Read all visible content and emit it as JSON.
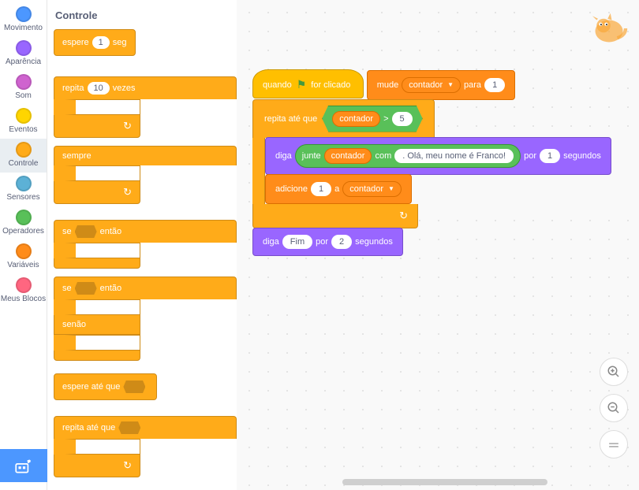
{
  "categories": [
    {
      "id": "movimento",
      "label": "Movimento",
      "color": "#4c97ff"
    },
    {
      "id": "aparencia",
      "label": "Aparência",
      "color": "#9966ff"
    },
    {
      "id": "som",
      "label": "Som",
      "color": "#cf63cf"
    },
    {
      "id": "eventos",
      "label": "Eventos",
      "color": "#ffd500"
    },
    {
      "id": "controle",
      "label": "Controle",
      "color": "#ffab19",
      "active": true
    },
    {
      "id": "sensores",
      "label": "Sensores",
      "color": "#5cb1d6"
    },
    {
      "id": "operadores",
      "label": "Operadores",
      "color": "#59c059"
    },
    {
      "id": "variaveis",
      "label": "Variáveis",
      "color": "#ff8c1a"
    },
    {
      "id": "meusblocos",
      "label": "Meus Blocos",
      "color": "#ff6680"
    }
  ],
  "palette": {
    "title": "Controle",
    "wait": {
      "pre": "espere",
      "val": "1",
      "post": "seg"
    },
    "repeat": {
      "pre": "repita",
      "val": "10",
      "post": "vezes"
    },
    "forever": {
      "label": "sempre"
    },
    "if": {
      "pre": "se",
      "post": "então"
    },
    "ifelse": {
      "pre": "se",
      "post": "então",
      "else": "senão"
    },
    "waituntil": {
      "label": "espere até que"
    },
    "repeatuntil": {
      "label": "repita até que"
    }
  },
  "script": {
    "hat": {
      "pre": "quando",
      "post": "for clicado"
    },
    "set": {
      "pre": "mude",
      "var": "contador",
      "mid": "para",
      "val": "1"
    },
    "repeatuntil": {
      "label": "repita até que"
    },
    "cond": {
      "var": "contador",
      "op": ">",
      "val": "5"
    },
    "say1": {
      "pre": "diga",
      "join": "junte",
      "var": "contador",
      "mid": "com",
      "text": ". Olá, meu nome é Franco!",
      "por": "por",
      "secval": "1",
      "sec": "segundos"
    },
    "change": {
      "pre": "adicione",
      "val": "1",
      "mid": "a",
      "var": "contador"
    },
    "say2": {
      "pre": "diga",
      "text": "Fim",
      "por": "por",
      "secval": "2",
      "sec": "segundos"
    }
  },
  "zoom": {
    "in": "＋",
    "out": "－",
    "eq": "＝"
  }
}
